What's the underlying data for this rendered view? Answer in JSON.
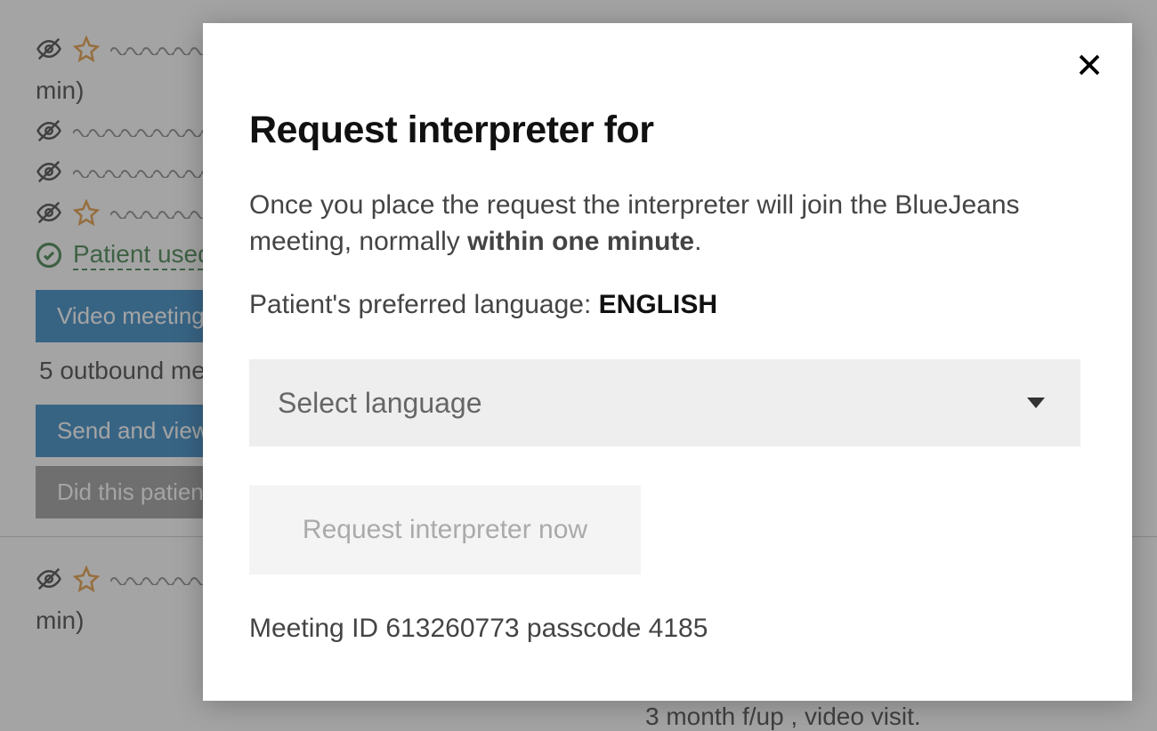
{
  "background": {
    "min_label_1": "min)",
    "patient_used": "Patient used",
    "video_meeting_btn": "Video meeting",
    "outbound_text": "5 outbound me",
    "send_view_btn": "Send and view",
    "did_patient_btn": "Did this patien",
    "min_label_2": "min)",
    "fragment": "3 month f/up , video visit."
  },
  "modal": {
    "title": "Request interpreter for",
    "desc_before": "Once you place the request the interpreter will join the BlueJeans meeting, normally ",
    "desc_bold": "within one minute",
    "desc_after": ".",
    "pref_label": "Patient's preferred language: ",
    "pref_value": "ENGLISH",
    "select_placeholder": "Select language",
    "request_btn": "Request interpreter now",
    "meeting_info": "Meeting ID 613260773 passcode 4185"
  }
}
